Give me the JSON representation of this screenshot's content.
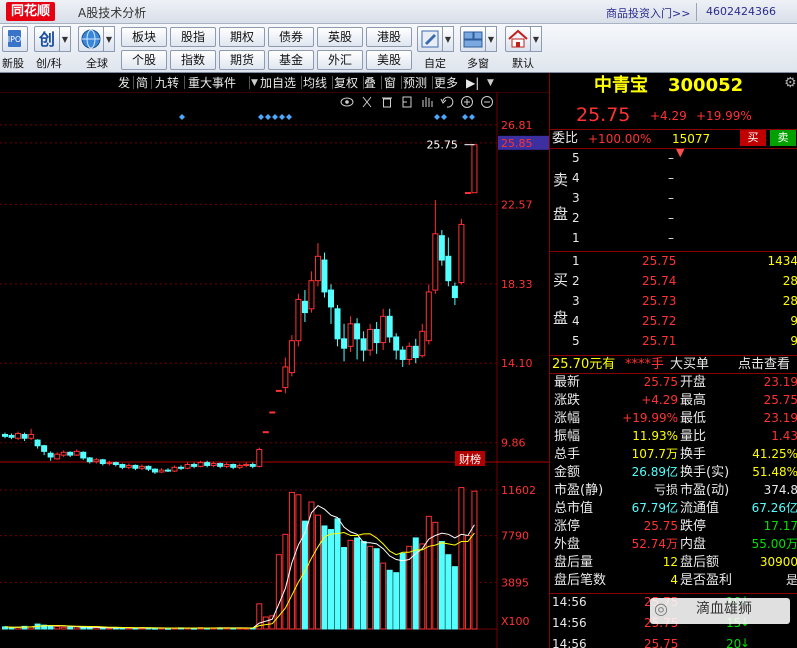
{
  "window": {
    "logo": "同花顺",
    "title": "A股技术分析",
    "promo": "商品投资入门>>",
    "phone": "4602424366"
  },
  "toolbar": {
    "left_items": [
      {
        "label": "新股",
        "icon": "ipo-icon"
      },
      {
        "label": "创/科",
        "icon": "chuang-icon"
      },
      {
        "label": "全球",
        "icon": "globe-icon"
      }
    ],
    "grid_row1": [
      "板块",
      "股指",
      "期权",
      "债券",
      "英股",
      "港股"
    ],
    "grid_row2": [
      "个股",
      "指数",
      "期货",
      "基金",
      "外汇",
      "美股"
    ],
    "right_items": [
      {
        "label": "自定",
        "icon": "custom-icon"
      },
      {
        "label": "多窗",
        "icon": "multi-window-icon"
      },
      {
        "label": "默认",
        "icon": "home-icon"
      }
    ]
  },
  "chartbar": {
    "items": [
      "发",
      "简",
      "九转",
      "重大事件",
      "加自选",
      "均线",
      "复权",
      "叠",
      "窗",
      "预测",
      "更多"
    ]
  },
  "chart": {
    "price_ticks": [
      "26.81",
      "25.85",
      "22.57",
      "18.33",
      "14.10",
      "9.86"
    ],
    "last_price_label": "25.75",
    "news_tag": "财榜",
    "volume_ticks": [
      "11602",
      "7790",
      "3895"
    ],
    "volume_unit": "X100",
    "tool_icons": [
      "eye-icon",
      "scissors-icon",
      "trash-icon",
      "rule-icon",
      "hand-icon",
      "undo-icon",
      "zoom-in-icon",
      "zoom-out-icon"
    ],
    "colors": {
      "up": "#ff3232",
      "down": "#54ffff",
      "ma_white": "#ffffff",
      "ma_yellow": "#ffff00",
      "grid": "#700000"
    }
  },
  "chart_data": {
    "type": "candlestick",
    "price_axis_ticks": [
      26.81,
      25.85,
      22.57,
      18.33,
      14.1,
      9.86
    ],
    "volume_axis_ticks": [
      11602,
      7790,
      3895
    ],
    "volume_unit": "X100",
    "last_close": 25.75,
    "candles": [
      {
        "o": 10.3,
        "c": 10.2,
        "h": 10.4,
        "l": 10.1
      },
      {
        "o": 10.25,
        "c": 10.15,
        "h": 10.35,
        "l": 10.05
      },
      {
        "o": 10.1,
        "c": 10.35,
        "h": 10.45,
        "l": 10.0
      },
      {
        "o": 10.3,
        "c": 10.1,
        "h": 10.4,
        "l": 9.95
      },
      {
        "o": 10.1,
        "c": 10.3,
        "h": 10.6,
        "l": 10.0
      },
      {
        "o": 10.0,
        "c": 9.7,
        "h": 10.05,
        "l": 9.55
      },
      {
        "o": 9.7,
        "c": 9.4,
        "h": 9.75,
        "l": 9.2
      },
      {
        "o": 9.3,
        "c": 9.1,
        "h": 9.4,
        "l": 8.9
      },
      {
        "o": 9.0,
        "c": 9.25,
        "h": 9.35,
        "l": 8.95
      },
      {
        "o": 9.2,
        "c": 9.35,
        "h": 9.45,
        "l": 9.1
      },
      {
        "o": 9.35,
        "c": 9.2,
        "h": 9.4,
        "l": 9.1
      },
      {
        "o": 9.2,
        "c": 9.4,
        "h": 9.5,
        "l": 9.15
      },
      {
        "o": 9.35,
        "c": 9.05,
        "h": 9.4,
        "l": 8.95
      },
      {
        "o": 9.05,
        "c": 8.85,
        "h": 9.1,
        "l": 8.75
      },
      {
        "o": 8.85,
        "c": 8.95,
        "h": 9.05,
        "l": 8.75
      },
      {
        "o": 8.95,
        "c": 8.75,
        "h": 9.0,
        "l": 8.65
      },
      {
        "o": 8.75,
        "c": 8.8,
        "h": 8.9,
        "l": 8.65
      },
      {
        "o": 8.8,
        "c": 8.7,
        "h": 8.85,
        "l": 8.6
      },
      {
        "o": 8.7,
        "c": 8.55,
        "h": 8.75,
        "l": 8.45
      },
      {
        "o": 8.55,
        "c": 8.65,
        "h": 8.75,
        "l": 8.45
      },
      {
        "o": 8.65,
        "c": 8.5,
        "h": 8.7,
        "l": 8.4
      },
      {
        "o": 8.5,
        "c": 8.6,
        "h": 8.7,
        "l": 8.4
      },
      {
        "o": 8.6,
        "c": 8.45,
        "h": 8.65,
        "l": 8.35
      },
      {
        "o": 8.45,
        "c": 8.3,
        "h": 8.5,
        "l": 8.2
      },
      {
        "o": 8.3,
        "c": 8.4,
        "h": 8.5,
        "l": 8.25
      },
      {
        "o": 8.4,
        "c": 8.35,
        "h": 8.5,
        "l": 8.3
      },
      {
        "o": 8.35,
        "c": 8.55,
        "h": 8.65,
        "l": 8.3
      },
      {
        "o": 8.55,
        "c": 8.5,
        "h": 8.65,
        "l": 8.4
      },
      {
        "o": 8.5,
        "c": 8.7,
        "h": 8.8,
        "l": 8.45
      },
      {
        "o": 8.7,
        "c": 8.6,
        "h": 8.8,
        "l": 8.5
      },
      {
        "o": 8.6,
        "c": 8.8,
        "h": 8.9,
        "l": 8.55
      },
      {
        "o": 8.8,
        "c": 8.65,
        "h": 8.9,
        "l": 8.55
      },
      {
        "o": 8.65,
        "c": 8.75,
        "h": 8.85,
        "l": 8.55
      },
      {
        "o": 8.75,
        "c": 8.6,
        "h": 8.8,
        "l": 8.5
      },
      {
        "o": 8.6,
        "c": 8.7,
        "h": 8.8,
        "l": 8.5
      },
      {
        "o": 8.7,
        "c": 8.55,
        "h": 8.75,
        "l": 8.45
      },
      {
        "o": 8.55,
        "c": 8.65,
        "h": 8.75,
        "l": 8.45
      },
      {
        "o": 8.65,
        "c": 8.7,
        "h": 8.8,
        "l": 8.55
      },
      {
        "o": 8.7,
        "c": 8.6,
        "h": 8.8,
        "l": 8.5
      },
      {
        "o": 8.6,
        "c": 9.5,
        "h": 9.6,
        "l": 8.55
      },
      {
        "o": 10.45,
        "c": 10.45,
        "h": 10.45,
        "l": 10.45
      },
      {
        "o": 11.5,
        "c": 11.5,
        "h": 11.5,
        "l": 11.5
      },
      {
        "o": 12.65,
        "c": 12.65,
        "h": 12.65,
        "l": 12.65
      },
      {
        "o": 12.8,
        "c": 13.9,
        "h": 14.4,
        "l": 12.5
      },
      {
        "o": 13.6,
        "c": 15.3,
        "h": 15.6,
        "l": 13.4
      },
      {
        "o": 15.3,
        "c": 17.5,
        "h": 17.8,
        "l": 15.0
      },
      {
        "o": 17.4,
        "c": 16.8,
        "h": 18.0,
        "l": 16.3
      },
      {
        "o": 17.0,
        "c": 18.5,
        "h": 19.0,
        "l": 16.8
      },
      {
        "o": 18.5,
        "c": 19.8,
        "h": 20.5,
        "l": 18.2
      },
      {
        "o": 19.6,
        "c": 17.9,
        "h": 20.0,
        "l": 17.6
      },
      {
        "o": 18.0,
        "c": 17.1,
        "h": 18.3,
        "l": 16.2
      },
      {
        "o": 17.0,
        "c": 15.4,
        "h": 17.2,
        "l": 15.0
      },
      {
        "o": 15.4,
        "c": 14.9,
        "h": 16.2,
        "l": 14.2
      },
      {
        "o": 15.0,
        "c": 16.2,
        "h": 16.6,
        "l": 14.7
      },
      {
        "o": 16.2,
        "c": 15.4,
        "h": 16.5,
        "l": 14.3
      },
      {
        "o": 15.4,
        "c": 14.8,
        "h": 15.8,
        "l": 14.2
      },
      {
        "o": 14.8,
        "c": 15.9,
        "h": 16.2,
        "l": 14.5
      },
      {
        "o": 15.9,
        "c": 15.2,
        "h": 16.3,
        "l": 14.6
      },
      {
        "o": 15.2,
        "c": 16.6,
        "h": 17.0,
        "l": 14.8
      },
      {
        "o": 16.6,
        "c": 15.5,
        "h": 17.0,
        "l": 15.2
      },
      {
        "o": 15.5,
        "c": 14.8,
        "h": 15.7,
        "l": 14.3
      },
      {
        "o": 14.8,
        "c": 14.3,
        "h": 15.0,
        "l": 13.9
      },
      {
        "o": 14.3,
        "c": 15.0,
        "h": 15.2,
        "l": 14.0
      },
      {
        "o": 15.0,
        "c": 14.4,
        "h": 15.4,
        "l": 14.1
      },
      {
        "o": 14.5,
        "c": 15.8,
        "h": 16.2,
        "l": 14.4
      },
      {
        "o": 15.3,
        "c": 17.9,
        "h": 18.3,
        "l": 15.1
      },
      {
        "o": 18.0,
        "c": 21.0,
        "h": 22.8,
        "l": 17.8
      },
      {
        "o": 20.9,
        "c": 19.6,
        "h": 21.2,
        "l": 19.3
      },
      {
        "o": 19.8,
        "c": 18.5,
        "h": 20.8,
        "l": 18.2
      },
      {
        "o": 18.2,
        "c": 17.6,
        "h": 18.4,
        "l": 17.2
      },
      {
        "o": 18.4,
        "c": 21.5,
        "h": 21.8,
        "l": 18.3
      },
      {
        "o": 23.2,
        "c": 23.2,
        "h": 23.2,
        "l": 23.2
      },
      {
        "o": 23.19,
        "c": 25.75,
        "h": 25.75,
        "l": 23.19
      }
    ],
    "volume": [
      180,
      120,
      140,
      220,
      180,
      410,
      320,
      260,
      210,
      150,
      160,
      190,
      120,
      110,
      130,
      90,
      80,
      120,
      95,
      100,
      80,
      105,
      90,
      70,
      85,
      60,
      75,
      95,
      85,
      70,
      110,
      80,
      90,
      95,
      100,
      85,
      90,
      70,
      85,
      2100,
      1000,
      1100,
      6200,
      7900,
      11400,
      11200,
      9000,
      10600,
      9500,
      8600,
      8300,
      9200,
      6800,
      7400,
      7600,
      7300,
      6900,
      6700,
      5500,
      4900,
      4700,
      6300,
      6900,
      7600,
      7100,
      9400,
      8900,
      7300,
      6200,
      5200,
      11800,
      7800,
      11502
    ],
    "ma5_volume": [
      180,
      150,
      147,
      165,
      168,
      226,
      266,
      284,
      280,
      270,
      222,
      194,
      166,
      150,
      142,
      120,
      104,
      108,
      103,
      97,
      95,
      100,
      94,
      89,
      86,
      82,
      77,
      77,
      80,
      79,
      85,
      84,
      85,
      89,
      91,
      92,
      92,
      88,
      86,
      492,
      650,
      816,
      2071,
      3400,
      5540,
      7020,
      8000,
      9700,
      10300,
      10000,
      9500,
      9300,
      8500,
      8100,
      7900,
      7200,
      7200,
      7100,
      6700,
      6100,
      5800,
      5700,
      5800,
      6300,
      6700,
      7500,
      7800,
      8000,
      7900,
      7600,
      7900,
      7800,
      8700
    ],
    "ma10_volume": [
      180,
      150,
      147,
      165,
      168,
      226,
      266,
      284,
      280,
      270,
      248,
      230,
      216,
      207,
      206,
      173,
      149,
      140,
      128,
      122,
      108,
      104,
      100,
      94,
      89,
      87,
      86,
      86,
      84,
      83,
      86,
      86,
      85,
      84,
      85,
      86,
      87,
      86,
      86,
      286,
      367,
      446,
      1075,
      1744,
      2824,
      3910,
      4810,
      5900,
      6860,
      7690,
      7930,
      7960,
      8050,
      7800,
      7800,
      7940,
      7950,
      7600,
      7100,
      6500,
      6200,
      6400,
      6400,
      6600,
      6600,
      6900,
      7000,
      7200,
      7100,
      7000,
      7300,
      7300,
      8000
    ]
  },
  "quote": {
    "name": "中青宝",
    "code": "300052",
    "price": "25.75",
    "change": "+4.29",
    "change_pct": "+19.99%",
    "weibi_label": "委比",
    "weibi_value": "+100.00%",
    "weibi_vol": "15077",
    "buy_btn": "买",
    "sell_btn": "卖",
    "sell_label": [
      "卖",
      "盘"
    ],
    "buy_label": [
      "买",
      "盘"
    ],
    "asks": [
      {
        "lvl": "5",
        "price": "–",
        "vol": ""
      },
      {
        "lvl": "4",
        "price": "–",
        "vol": ""
      },
      {
        "lvl": "3",
        "price": "–",
        "vol": ""
      },
      {
        "lvl": "2",
        "price": "–",
        "vol": ""
      },
      {
        "lvl": "1",
        "price": "–",
        "vol": ""
      }
    ],
    "bids": [
      {
        "lvl": "1",
        "price": "25.75",
        "vol": "1434"
      },
      {
        "lvl": "2",
        "price": "25.74",
        "vol": "28"
      },
      {
        "lvl": "3",
        "price": "25.73",
        "vol": "28"
      },
      {
        "lvl": "4",
        "price": "25.72",
        "vol": "9"
      },
      {
        "lvl": "5",
        "price": "25.71",
        "vol": "9"
      }
    ],
    "bigorder": {
      "price": "25.70元有",
      "stars": "****手",
      "label": "大买单",
      "link": "点击查看"
    },
    "stats": [
      {
        "l": "最新",
        "v": "25.75",
        "l2": "开盘",
        "v2": "23.19",
        "c": "#ff3232",
        "c2": "#ff3232"
      },
      {
        "l": "涨跌",
        "v": "+4.29",
        "l2": "最高",
        "v2": "25.75",
        "c": "#ff3232",
        "c2": "#ff3232"
      },
      {
        "l": "涨幅",
        "v": "+19.99%",
        "l2": "最低",
        "v2": "23.19",
        "c": "#ff3232",
        "c2": "#ff3232"
      },
      {
        "l": "振幅",
        "v": "11.93%",
        "l2": "量比",
        "v2": "1.43",
        "c": "#ffff00",
        "c2": "#ff3232"
      },
      {
        "l": "总手",
        "v": "107.7万",
        "l2": "换手",
        "v2": "41.25%",
        "c": "#ffff00",
        "c2": "#ffff00"
      },
      {
        "l": "金额",
        "v": "26.89亿",
        "l2": "换手(实)",
        "v2": "51.48%",
        "c": "#54ffff",
        "c2": "#ffff00"
      },
      {
        "l": "市盈(静)",
        "v": "亏损",
        "l2": "市盈(动)",
        "v2": "374.8",
        "c": "#e8e8e8",
        "c2": "#e8e8e8"
      },
      {
        "l": "总市值",
        "v": "67.79亿",
        "l2": "流通值",
        "v2": "67.26亿",
        "c": "#54ffff",
        "c2": "#54ffff"
      },
      {
        "l": "涨停",
        "v": "25.75",
        "l2": "跌停",
        "v2": "17.17",
        "c": "#ff3232",
        "c2": "#00e000"
      },
      {
        "l": "外盘",
        "v": "52.74万",
        "l2": "内盘",
        "v2": "55.00万",
        "c": "#ff3232",
        "c2": "#00e000"
      },
      {
        "l": "盘后量",
        "v": "12",
        "l2": "盘后额",
        "v2": "30900",
        "c": "#ffff00",
        "c2": "#ffff00"
      },
      {
        "l": "盘后笔数",
        "v": "4",
        "l2": "是否盈利",
        "v2": "是",
        "c": "#ffff00",
        "c2": "#e8e8e8"
      }
    ],
    "ticks": [
      {
        "t": "14:56",
        "p": "25.75",
        "v": "10"
      },
      {
        "t": "14:56",
        "p": "25.75",
        "v": "15"
      },
      {
        "t": "14:56",
        "p": "25.75",
        "v": "20"
      }
    ],
    "watermark": "滴血雄狮"
  }
}
